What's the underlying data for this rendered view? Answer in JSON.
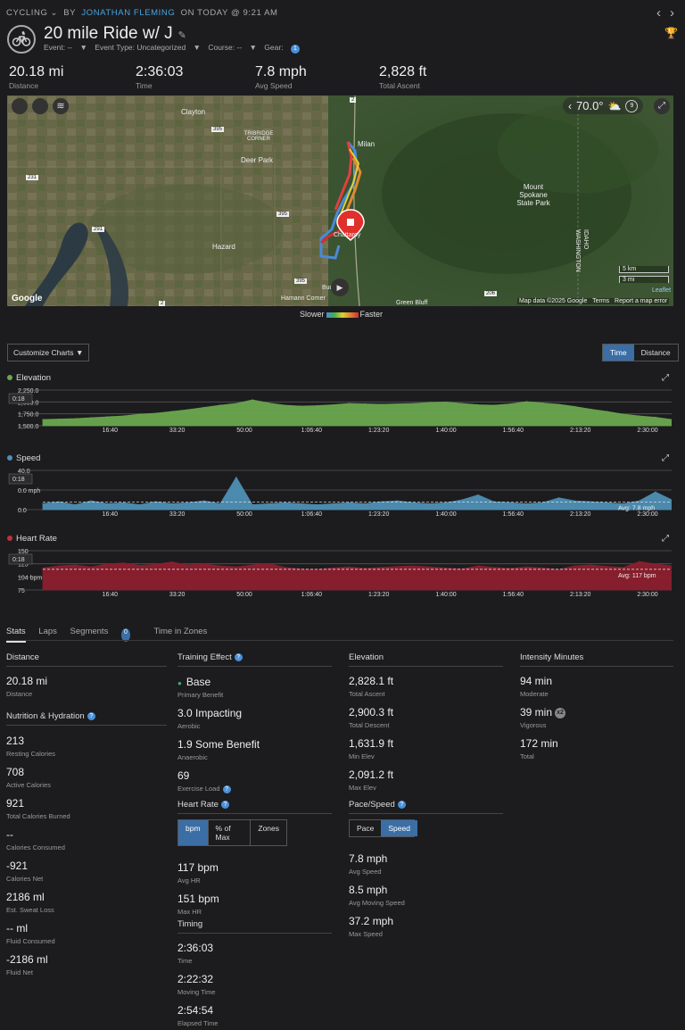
{
  "header": {
    "activity_type": "CYCLING",
    "by": "BY",
    "author": "JONATHAN FLEMING",
    "when": "ON TODAY @ 9:21 AM",
    "title": "20 mile Ride w/ J",
    "event_label": "Event: --",
    "event_type_label": "Event Type: Uncategorized",
    "course_label": "Course: --",
    "gear_label": "Gear:",
    "gear_count": "1",
    "prev_icon": "chevron-left-icon",
    "next_icon": "chevron-right-icon"
  },
  "summary": [
    {
      "value": "20.18 mi",
      "label": "Distance"
    },
    {
      "value": "2:36:03",
      "label": "Time"
    },
    {
      "value": "7.8 mph",
      "label": "Avg Speed"
    },
    {
      "value": "2,828 ft",
      "label": "Total Ascent"
    }
  ],
  "map": {
    "temperature": "70.0°",
    "weather_count": "9",
    "places": [
      "Clayton",
      "TRIBRIDGE CORNER",
      "Deer Park",
      "Milan",
      "Hazard",
      "Mount Spokane State Park",
      "IDAHO",
      "WASHINGTON",
      "Chattaroy",
      "Hamann Corner",
      "Green Bluff",
      "Buckeye"
    ],
    "road_numbers": [
      "2",
      "395",
      "395",
      "231",
      "291",
      "395",
      "206",
      "2"
    ],
    "scale_km": "5 km",
    "scale_mi": "3 mi",
    "attribution": "Map data ©2025 Google",
    "terms": "Terms",
    "report": "Report a map error",
    "leaflet": "Leaflet",
    "google": "Google",
    "legend_slower": "Slower",
    "legend_faster": "Faster"
  },
  "chart_controls": {
    "customize": "Customize Charts",
    "time": "Time",
    "distance": "Distance"
  },
  "chart_data": [
    {
      "type": "area",
      "title": "Elevation",
      "color": "#6aa84f",
      "y_ticks": [
        "2,250.0",
        "2,000.0",
        "1,750.0",
        "1,500.0"
      ],
      "ylim": [
        1500,
        2300
      ],
      "x_ticks": [
        "16:40",
        "33:20",
        "50:00",
        "1:06:40",
        "1:23:20",
        "1:40:00",
        "1:56:40",
        "2:13:20",
        "2:30:00"
      ],
      "cursor_label": "0:18",
      "x": [
        0,
        4,
        8,
        12,
        16,
        20,
        24,
        28,
        32,
        36,
        40,
        44,
        48,
        52,
        56,
        60,
        64,
        68,
        72,
        76,
        80,
        84,
        88,
        92,
        96,
        100,
        104,
        108,
        112,
        116,
        120,
        124,
        128,
        132,
        136,
        140,
        144,
        148,
        152,
        156
      ],
      "values": [
        1640,
        1650,
        1660,
        1680,
        1700,
        1720,
        1760,
        1780,
        1820,
        1860,
        1910,
        1960,
        2000,
        2080,
        2010,
        1960,
        1940,
        1950,
        1970,
        2000,
        1990,
        1980,
        1990,
        2000,
        2020,
        2030,
        2000,
        1970,
        1960,
        1990,
        2040,
        2010,
        1980,
        1930,
        1870,
        1820,
        1760,
        1720,
        1690,
        1640
      ]
    },
    {
      "type": "area",
      "title": "Speed",
      "color": "#4e8fb5",
      "y_ticks": [
        "40.0",
        "0.0 mph",
        "0.0"
      ],
      "ylim": [
        0,
        40
      ],
      "x_ticks": [
        "16:40",
        "33:20",
        "50:00",
        "1:06:40",
        "1:23:20",
        "1:40:00",
        "1:56:40",
        "2:13:20",
        "2:30:00"
      ],
      "cursor_label": "0:18",
      "avg_label": "Avg: 7.8 mph",
      "avg": 7.8,
      "x": [
        0,
        4,
        8,
        12,
        16,
        20,
        24,
        28,
        32,
        36,
        40,
        44,
        48,
        52,
        56,
        60,
        64,
        68,
        72,
        76,
        80,
        84,
        88,
        92,
        96,
        100,
        104,
        108,
        112,
        116,
        120,
        124,
        128,
        132,
        136,
        140,
        144,
        148,
        152,
        156
      ],
      "values": [
        6,
        8,
        5,
        9,
        6,
        7,
        5,
        8,
        6,
        7,
        9,
        6,
        33,
        5,
        6,
        7,
        6,
        5,
        6,
        7,
        6,
        8,
        9,
        7,
        6,
        7,
        10,
        15,
        8,
        7,
        6,
        7,
        12,
        9,
        8,
        7,
        6,
        9,
        18,
        10
      ]
    },
    {
      "type": "area",
      "title": "Heart Rate",
      "color": "#8c1f2e",
      "y_ticks": [
        "150",
        "125",
        "104 bpm",
        "75"
      ],
      "ylim": [
        75,
        155
      ],
      "x_ticks": [
        "16:40",
        "33:20",
        "50:00",
        "1:06:40",
        "1:23:20",
        "1:40:00",
        "1:56:40",
        "2:13:20",
        "2:30:00"
      ],
      "cursor_label": "0:18",
      "avg_label": "Avg: 117 bpm",
      "avg": 117,
      "x": [
        0,
        4,
        8,
        12,
        16,
        20,
        24,
        28,
        32,
        36,
        40,
        44,
        48,
        52,
        56,
        60,
        64,
        68,
        72,
        76,
        80,
        84,
        88,
        92,
        96,
        100,
        104,
        108,
        112,
        116,
        120,
        124,
        128,
        132,
        136,
        140,
        144,
        148,
        152,
        156
      ],
      "values": [
        120,
        124,
        126,
        122,
        128,
        130,
        125,
        127,
        132,
        126,
        128,
        124,
        122,
        126,
        129,
        121,
        118,
        117,
        120,
        122,
        119,
        121,
        123,
        124,
        122,
        120,
        118,
        124,
        121,
        119,
        122,
        120,
        117,
        124,
        126,
        123,
        121,
        133,
        128,
        124
      ]
    }
  ],
  "tabs": [
    {
      "label": "Stats"
    },
    {
      "label": "Laps"
    },
    {
      "label": "Segments",
      "badge": "0"
    },
    {
      "label": "Time in Zones"
    }
  ],
  "stats": {
    "distance": {
      "title": "Distance",
      "value": "20.18 mi",
      "label": "Distance"
    },
    "nutrition": {
      "title": "Nutrition & Hydration",
      "items": [
        {
          "value": "213",
          "label": "Resting Calories"
        },
        {
          "value": "708",
          "label": "Active Calories"
        },
        {
          "value": "921",
          "label": "Total Calories Burned"
        },
        {
          "value": "--",
          "label": "Calories Consumed"
        },
        {
          "value": "-921",
          "label": "Calories Net"
        },
        {
          "value": "2186 ml",
          "label": "Est. Sweat Loss"
        },
        {
          "value": "-- ml",
          "label": "Fluid Consumed"
        },
        {
          "value": "-2186 ml",
          "label": "Fluid Net"
        }
      ]
    },
    "training": {
      "title": "Training Effect",
      "items": [
        {
          "value": "Base",
          "label": "Primary Benefit"
        },
        {
          "value": "3.0 Impacting",
          "label": "Aerobic"
        },
        {
          "value": "1.9 Some Benefit",
          "label": "Anaerobic"
        },
        {
          "value": "69",
          "label": "Exercise Load"
        }
      ]
    },
    "heart_rate": {
      "title": "Heart Rate",
      "buttons": [
        "bpm",
        "% of Max",
        "Zones"
      ],
      "items": [
        {
          "value": "117 bpm",
          "label": "Avg HR"
        },
        {
          "value": "151 bpm",
          "label": "Max HR"
        }
      ]
    },
    "timing": {
      "title": "Timing",
      "items": [
        {
          "value": "2:36:03",
          "label": "Time"
        },
        {
          "value": "2:22:32",
          "label": "Moving Time"
        },
        {
          "value": "2:54:54",
          "label": "Elapsed Time"
        }
      ]
    },
    "elevation": {
      "title": "Elevation",
      "items": [
        {
          "value": "2,828.1 ft",
          "label": "Total Ascent"
        },
        {
          "value": "2,900.3 ft",
          "label": "Total Descent"
        },
        {
          "value": "1,631.9 ft",
          "label": "Min Elev"
        },
        {
          "value": "2,091.2 ft",
          "label": "Max Elev"
        }
      ]
    },
    "pace_speed": {
      "title": "Pace/Speed",
      "buttons": [
        "Pace",
        "Speed"
      ],
      "items": [
        {
          "value": "7.8 mph",
          "label": "Avg Speed"
        },
        {
          "value": "8.5 mph",
          "label": "Avg Moving Speed"
        },
        {
          "value": "37.2 mph",
          "label": "Max Speed"
        }
      ]
    },
    "intensity": {
      "title": "Intensity Minutes",
      "items": [
        {
          "value": "94 min",
          "label": "Moderate"
        },
        {
          "value": "39 min",
          "label": "Vigorous",
          "badge": "x2"
        },
        {
          "value": "172 min",
          "label": "Total"
        }
      ]
    }
  }
}
